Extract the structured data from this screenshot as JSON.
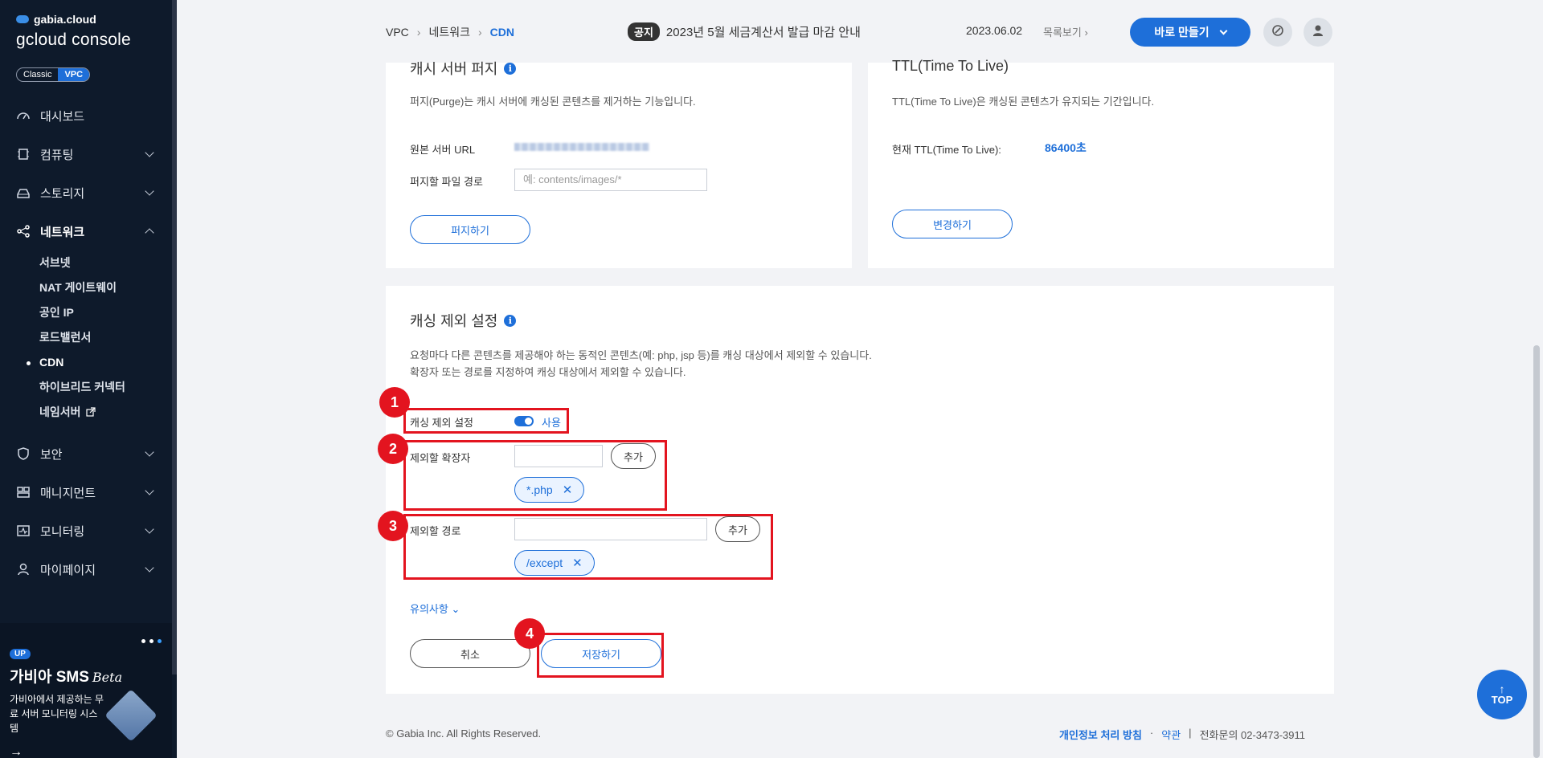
{
  "sidebar": {
    "brand_small": "gabia.cloud",
    "brand_big": "gcloud console",
    "mode_classic": "Classic",
    "mode_vpc": "VPC",
    "items": [
      {
        "label": "대시보드"
      },
      {
        "label": "컴퓨팅"
      },
      {
        "label": "스토리지"
      },
      {
        "label": "네트워크"
      },
      {
        "label": "보안"
      },
      {
        "label": "매니지먼트"
      },
      {
        "label": "모니터링"
      },
      {
        "label": "마이페이지"
      }
    ],
    "network_sub": [
      "서브넷",
      "NAT 게이트웨이",
      "공인 IP",
      "로드밸런서",
      "CDN",
      "하이브리드 커넥터",
      "네임서버"
    ],
    "promo": {
      "badge": "UP",
      "title": "가비아 SMS",
      "title_em": "Beta",
      "desc": "가비아에서 제공하는 무료 서버 모니터링 시스템",
      "arrow": "→"
    }
  },
  "topbar": {
    "breadcrumb": [
      "VPC",
      "네트워크",
      "CDN"
    ],
    "notice_tag": "공지",
    "notice_text": "2023년 5월 세금계산서 발급 마감 안내",
    "notice_date": "2023.06.02",
    "notice_more": "목록보기",
    "make_button": "바로 만들기"
  },
  "purge": {
    "title": "캐시 서버 퍼지",
    "desc": "퍼지(Purge)는 캐시 서버에 캐싱된 콘텐츠를 제거하는 기능입니다.",
    "origin_label": "원본 서버 URL",
    "path_label": "퍼지할 파일 경로",
    "path_placeholder": "예: contents/images/*",
    "button": "퍼지하기"
  },
  "ttl": {
    "title": "TTL(Time To Live)",
    "desc": "TTL(Time To Live)은 캐싱된 콘텐츠가 유지되는 기간입니다.",
    "current_label": "현재 TTL(Time To Live):",
    "current_value": "86400초",
    "button": "변경하기"
  },
  "exclusion": {
    "title": "캐싱 제외 설정",
    "desc_line1": "요청마다 다른 콘텐츠를 제공해야 하는 동적인 콘텐츠(예: php, jsp 등)를 캐싱 대상에서 제외할 수 있습니다.",
    "desc_line2": "확장자 또는 경로를 지정하여 캐싱 대상에서 제외할 수 있습니다.",
    "toggle_label": "캐싱 제외 설정",
    "toggle_state": "사용",
    "ext_label": "제외할 확장자",
    "ext_add": "추가",
    "ext_chip": "*.php",
    "path_label": "제외할 경로",
    "path_add": "추가",
    "path_chip": "/except",
    "notes_link": "유의사항",
    "cancel": "취소",
    "save": "저장하기"
  },
  "badges": [
    "1",
    "2",
    "3",
    "4"
  ],
  "footer": {
    "copyright": "© Gabia Inc. All Rights Reserved.",
    "privacy": "개인정보 처리 방침",
    "dot": "·",
    "terms": "약관",
    "pipe": "|",
    "contact": "전화문의 02-3473-3911"
  },
  "top_button": "TOP",
  "colors": {
    "accent": "#1e6fd9",
    "sidebar": "#0e1a2b",
    "highlight": "#e3141f"
  }
}
